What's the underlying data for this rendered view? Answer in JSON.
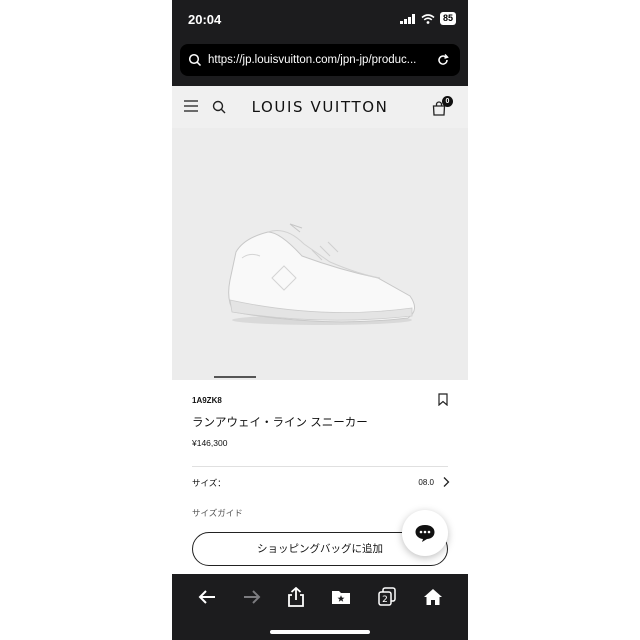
{
  "status_bar": {
    "time": "20:04",
    "battery": "85"
  },
  "browser": {
    "url": "https://jp.louisvuitton.com/jpn-jp/produc..."
  },
  "header": {
    "brand": "LOUIS VUITTON",
    "cart_count": "0"
  },
  "product": {
    "sku": "1A9ZK8",
    "name": "ランアウェイ・ライン スニーカー",
    "price": "¥146,300",
    "size_label": "サイズ：",
    "size_value": "08.0",
    "size_guide": "サイズガイド",
    "add_to_cart": "ショッピングバッグに追加"
  },
  "toolbar": {
    "tab_count": "2"
  },
  "colors": {
    "chrome": "#1c1c1e",
    "hero_bg": "#ececec",
    "header_bg": "#f0f0f0"
  },
  "icons": [
    "menu-icon",
    "search-icon",
    "shopping-bag-icon",
    "bookmark-icon",
    "chevron-right-icon",
    "chat-icon",
    "back-icon",
    "forward-icon",
    "share-icon",
    "bookmarks-icon",
    "tabs-icon",
    "home-icon"
  ]
}
